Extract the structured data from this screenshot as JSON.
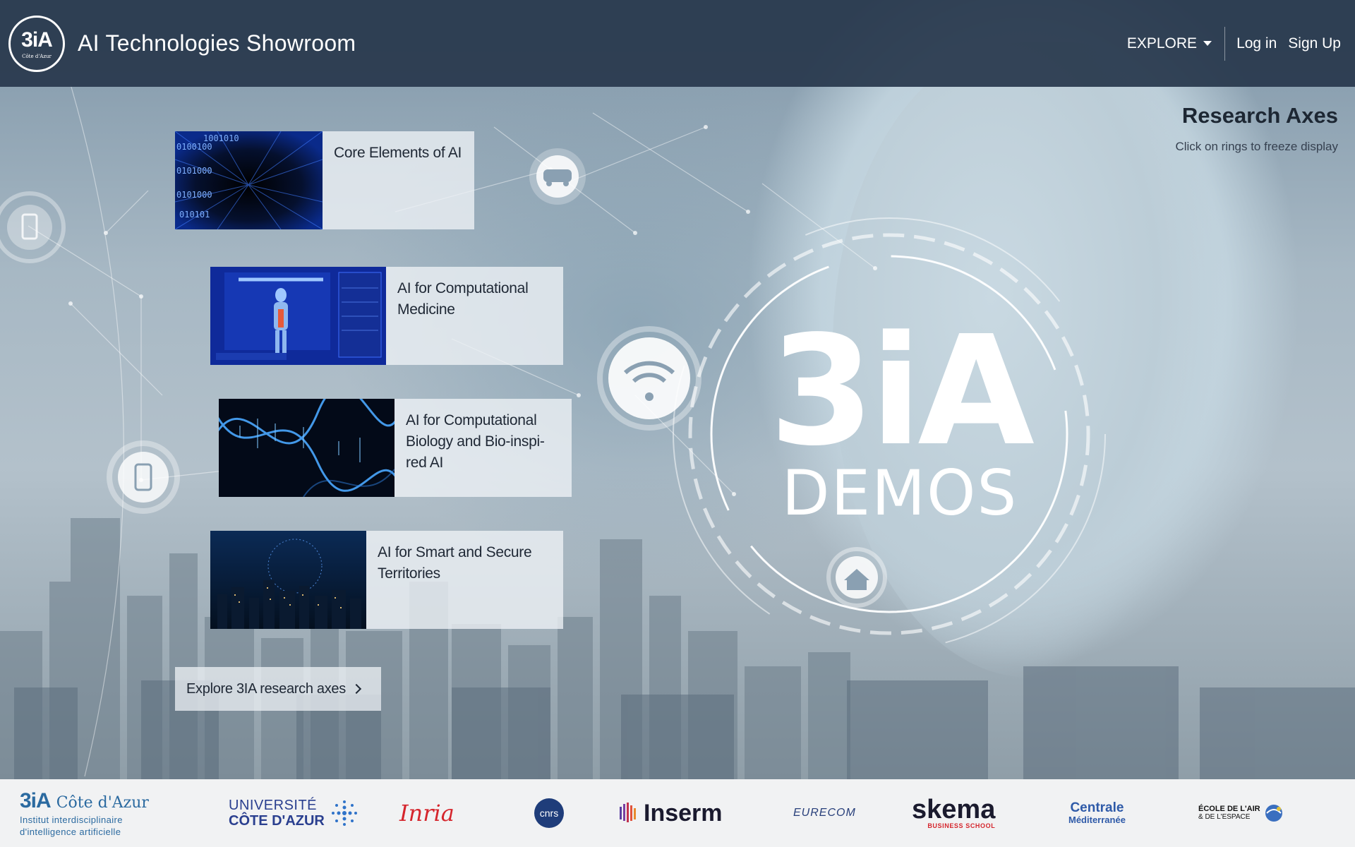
{
  "navbar": {
    "logo_mark": "3iA",
    "logo_sub": "Côte d'Azur",
    "title": "AI Technologies Showroom",
    "explore_label": "EXPLORE",
    "login_label": "Log in",
    "signup_label": "Sign Up"
  },
  "research_axes": {
    "title": "Research Axes",
    "hint": "Click on rings to freeze display"
  },
  "cards": [
    {
      "label": "Core Elements of AI",
      "thumb_icon": "binary-tunnel-image"
    },
    {
      "label": "AI for Computational Medicine",
      "thumb_icon": "human-body-scan-image"
    },
    {
      "label": "AI for Computational Biology and Bio-inspi-red AI",
      "thumb_icon": "dna-helix-image"
    },
    {
      "label": "AI for Smart and Secure Territories",
      "thumb_icon": "night-city-image"
    }
  ],
  "explore_button": {
    "label": "Explore 3IA research axes"
  },
  "demo_mark": {
    "big": "3iA",
    "small": "DEMOS"
  },
  "partners": {
    "threeia": {
      "mark": "3iA",
      "name": "Côte d'Azur",
      "tagline1": "Institut interdisciplinaire",
      "tagline2": "d'intelligence artificielle"
    },
    "uca": {
      "line1": "UNIVERSITÉ",
      "line2": "CÔTE D'AZUR"
    },
    "inria": {
      "name": "Inria"
    },
    "cnrs": {
      "name": "cnrs"
    },
    "inserm": {
      "name": "Inserm"
    },
    "eurecom": {
      "name": "EURECOM"
    },
    "skema": {
      "name": "skema",
      "sub": "BUSINESS SCHOOL"
    },
    "centrale": {
      "name": "Centrale",
      "sub": "Méditerranée"
    },
    "ecole": {
      "line1": "ÉCOLE DE L'AIR",
      "line2": "& DE L'ESPACE"
    }
  },
  "colors": {
    "navbar_bg": "#28384c",
    "card_bg": "#eef2f6",
    "accent_blue": "#2b6aa0",
    "inria_red": "#d5252c"
  }
}
